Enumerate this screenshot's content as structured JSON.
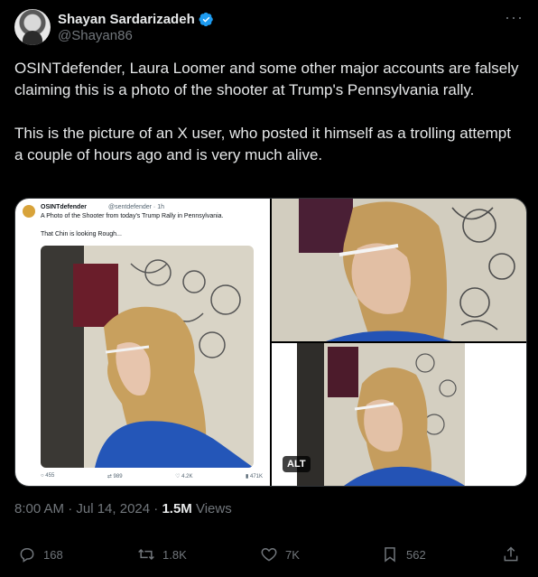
{
  "author": {
    "display_name": "Shayan Sardarizadeh",
    "handle": "@Shayan86",
    "verified": true
  },
  "more_icon": "more-dots-icon",
  "tweet": {
    "paragraph1": "OSINTdefender, Laura Loomer and some other major accounts are falsely claiming this is a photo of the shooter at Trump's Pennsylvania rally.",
    "paragraph2": "This is the picture of an X user, who posted it himself as a trolling attempt a couple of hours ago and is very much alive."
  },
  "embedded_post": {
    "name": "OSINTdefender",
    "handle": "@sentdefender · 1h",
    "text1": "A Photo of the Shooter from today's Trump Rally in Pennsylvania.",
    "text2": "That Chin is looking Rough...",
    "replies": "455",
    "reposts": "989",
    "likes": "4.2K",
    "views": "471K"
  },
  "media": {
    "alt_label": "ALT"
  },
  "meta": {
    "time": "8:00 AM · Jul 14, 2024 · ",
    "views_count": "1.5M",
    "views_label": " Views"
  },
  "actions": {
    "replies": "168",
    "reposts": "1.8K",
    "likes": "7K",
    "bookmarks": "562"
  },
  "colors": {
    "background": "#000000",
    "text": "#e7e9ea",
    "muted": "#71767b",
    "verified": "#1d9bf0"
  }
}
